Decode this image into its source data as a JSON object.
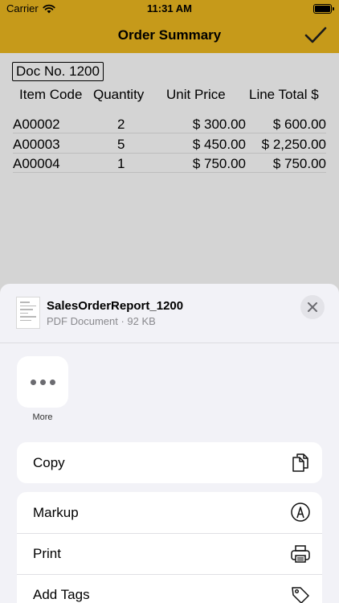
{
  "status_bar": {
    "carrier": "Carrier",
    "time": "11:31 AM",
    "icons": [
      "wifi-icon",
      "battery-icon"
    ]
  },
  "nav": {
    "title": "Order Summary",
    "done_icon": "checkmark-icon"
  },
  "document": {
    "doc_no": "Doc No. 1200",
    "columns": [
      "Item Code",
      "Quantity",
      "Unit Price",
      "Line Total $"
    ],
    "rows": [
      {
        "code": "A00002",
        "qty": "2",
        "price": "$ 300.00",
        "total": "$ 600.00"
      },
      {
        "code": "A00003",
        "qty": "5",
        "price": "$ 450.00",
        "total": "$ 2,250.00"
      },
      {
        "code": "A00004",
        "qty": "1",
        "price": "$ 750.00",
        "total": "$ 750.00"
      }
    ]
  },
  "share_sheet": {
    "file_name": "SalesOrderReport_1200",
    "file_meta": "PDF Document · 92 KB",
    "apps": [
      {
        "label": "More",
        "icon": "more-icon"
      }
    ],
    "actions_group1": [
      {
        "label": "Copy",
        "icon": "copy-icon"
      }
    ],
    "actions_group2": [
      {
        "label": "Markup",
        "icon": "markup-icon"
      },
      {
        "label": "Print",
        "icon": "print-icon"
      },
      {
        "label": "Add Tags",
        "icon": "tag-icon"
      }
    ]
  },
  "colors": {
    "nav_background": "#c69a1a",
    "content_background": "#d4d4d4",
    "sheet_background": "#f2f2f7"
  }
}
